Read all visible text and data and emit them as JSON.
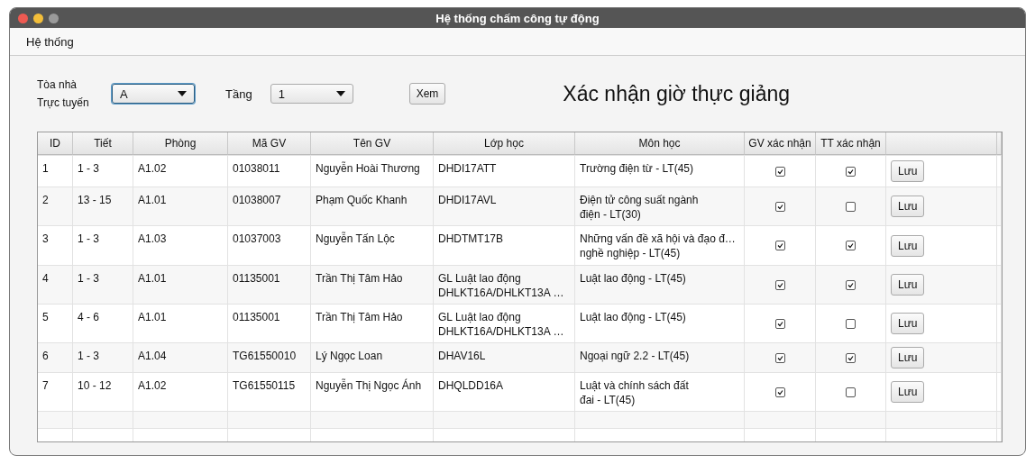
{
  "window": {
    "title": "Hệ thống chấm công tự động"
  },
  "menu": [
    "Hệ thống"
  ],
  "filters": {
    "building_label": "Tòa nhà",
    "online_label": "Trực tuyến",
    "building_value": "A",
    "floor_label": "Tầng",
    "floor_value": "1",
    "view_button": "Xem"
  },
  "heading": "Xác nhận giờ thực giảng",
  "table": {
    "columns": [
      "ID",
      "Tiết",
      "Phòng",
      "Mã GV",
      "Tên GV",
      "Lớp học",
      "Môn học",
      "GV xác nhận",
      "TT xác nhận"
    ],
    "rows": [
      {
        "cells": [
          "1",
          "1 - 3",
          "A1.02",
          "01038011",
          "Nguyễn Hoài Thương",
          "DHDI17ATT",
          "Trường điện từ - LT(45)"
        ],
        "gv_confirmed": true,
        "tt_confirmed": true,
        "button": "Lưu"
      },
      {
        "cells": [
          "2",
          "13 - 15",
          "A1.01",
          "01038007",
          "Phạm Quốc Khanh",
          "DHDI17AVL",
          "Điện tử công suất ngành\nđiện - LT(30)"
        ],
        "gv_confirmed": true,
        "tt_confirmed": false,
        "button": "Lưu"
      },
      {
        "cells": [
          "3",
          "1 - 3",
          "A1.03",
          "01037003",
          "Nguyễn Tấn Lộc",
          "DHDTMT17B",
          "Những vấn đề xã hội và đạo đ…\nnghề nghiệp - LT(45)"
        ],
        "gv_confirmed": true,
        "tt_confirmed": true,
        "button": "Lưu"
      },
      {
        "cells": [
          "4",
          "1 - 3",
          "A1.01",
          "01135001",
          "Trần Thị Tâm Hảo",
          "GL Luật lao động\nDHLKT16A/DHLKT13A  …",
          "Luật lao động - LT(45)"
        ],
        "gv_confirmed": true,
        "tt_confirmed": true,
        "button": "Lưu"
      },
      {
        "cells": [
          "5",
          "4 - 6",
          "A1.01",
          "01135001",
          "Trần Thị Tâm Hảo",
          "GL Luật lao động\nDHLKT16A/DHLKT13A  …",
          "Luật lao động - LT(45)"
        ],
        "gv_confirmed": true,
        "tt_confirmed": false,
        "button": "Lưu"
      },
      {
        "cells": [
          "6",
          "1 - 3",
          "A1.04",
          "TG61550010",
          "Lý Ngọc Loan",
          "DHAV16L",
          "Ngoại ngữ 2.2 - LT(45)"
        ],
        "gv_confirmed": true,
        "tt_confirmed": true,
        "button": "Lưu"
      },
      {
        "cells": [
          "7",
          "10 - 12",
          "A1.02",
          "TG61550115",
          "Nguyễn Thị Ngọc Ánh",
          "DHQLDD16A",
          "Luật và chính sách đất\nđai - LT(45)"
        ],
        "gv_confirmed": true,
        "tt_confirmed": false,
        "button": "Lưu"
      }
    ]
  }
}
